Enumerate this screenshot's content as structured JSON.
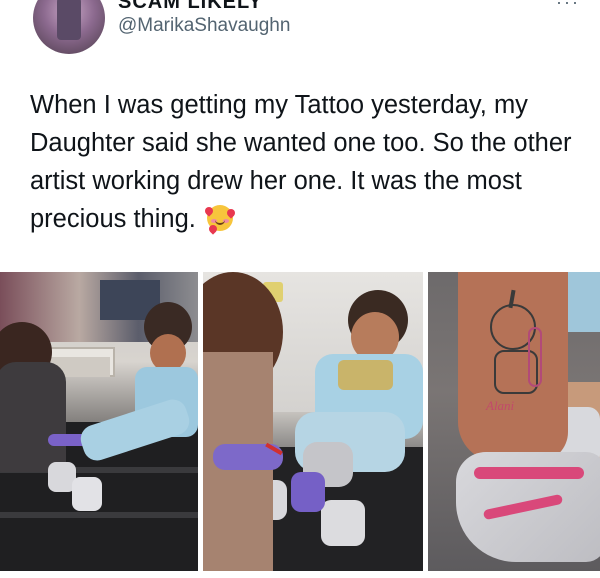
{
  "header": {
    "display_name": "SCAM LIKELY",
    "handle": "@MarikaShavaughn",
    "more_label": "···"
  },
  "tweet": {
    "text": "When I was getting my Tattoo yesterday, my Daughter said she wanted one too. So the other artist working drew her one. It was the most precious thing.",
    "emoji_icon": "smiling-face-with-hearts-icon"
  },
  "media": {
    "photos": [
      {
        "label": "tattoo-parlor-photo-left"
      },
      {
        "label": "tattoo-parlor-photo-middle"
      },
      {
        "label": "leg-drawing-closeup-photo"
      }
    ],
    "drawing_caption": "Alani"
  },
  "colors": {
    "text_primary": "#0f1419",
    "text_secondary": "#536471",
    "background": "#ffffff"
  }
}
